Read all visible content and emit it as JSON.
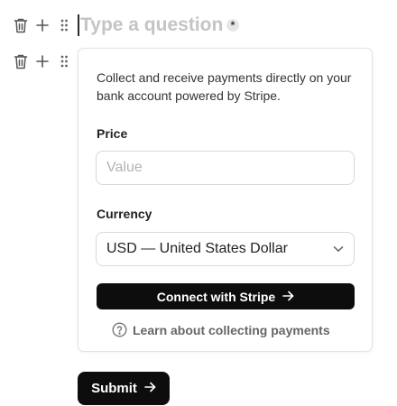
{
  "question_block": {
    "placeholder": "Type a question",
    "required_marker": "*"
  },
  "payment_block": {
    "description": "Collect and receive payments directly on your bank account powered by Stripe.",
    "price_label": "Price",
    "price_placeholder": "Value",
    "price_value": "",
    "currency_label": "Currency",
    "currency_selected": "USD — United States Dollar",
    "connect_label": "Connect with Stripe",
    "learn_label": "Learn about collecting payments"
  },
  "form": {
    "submit_label": "Submit"
  },
  "icons": {
    "row_controls": [
      "trash-icon",
      "plus-icon",
      "drag-handle-icon"
    ],
    "arrow": "arrow-right-icon",
    "help": "help-circle-icon",
    "select": "chevron-down-icon"
  },
  "colors": {
    "primary_button": "#0d0d0d",
    "placeholder_text": "#c4c4c4",
    "border": "#d9d9d9"
  }
}
